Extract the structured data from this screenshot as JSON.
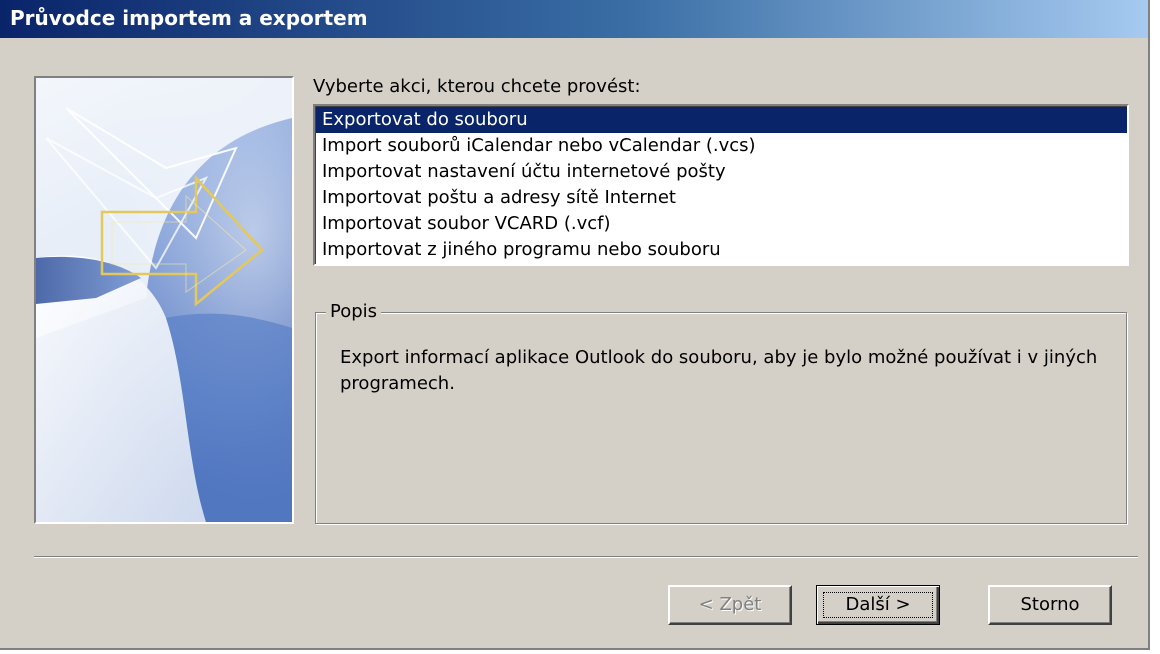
{
  "window": {
    "title": "Průvodce importem a exportem"
  },
  "main": {
    "prompt": "Vyberte akci, kterou chcete provést:",
    "actions": [
      {
        "label": "Exportovat do souboru",
        "selected": true
      },
      {
        "label": "Import souborů iCalendar nebo vCalendar (.vcs)",
        "selected": false
      },
      {
        "label": "Importovat nastavení účtu internetové pošty",
        "selected": false
      },
      {
        "label": "Importovat poštu a adresy sítě Internet",
        "selected": false
      },
      {
        "label": "Importovat soubor VCARD (.vcf)",
        "selected": false
      },
      {
        "label": "Importovat z jiného programu nebo souboru",
        "selected": false
      }
    ],
    "description_group": {
      "legend": "Popis",
      "text": "Export informací aplikace Outlook do souboru, aby je bylo možné používat i v jiných programech."
    }
  },
  "buttons": {
    "back": {
      "label": "< Zpět",
      "enabled": false
    },
    "next": {
      "label": "Další >",
      "enabled": true
    },
    "cancel": {
      "label": "Storno",
      "enabled": true
    }
  },
  "colors": {
    "title_bar_start": "#0a246a",
    "title_bar_end": "#a6caf0",
    "selection": "#0a246a",
    "dialog_face": "#d4d0c8"
  },
  "icons": {
    "banner": "import-export-arrow-graphic"
  }
}
